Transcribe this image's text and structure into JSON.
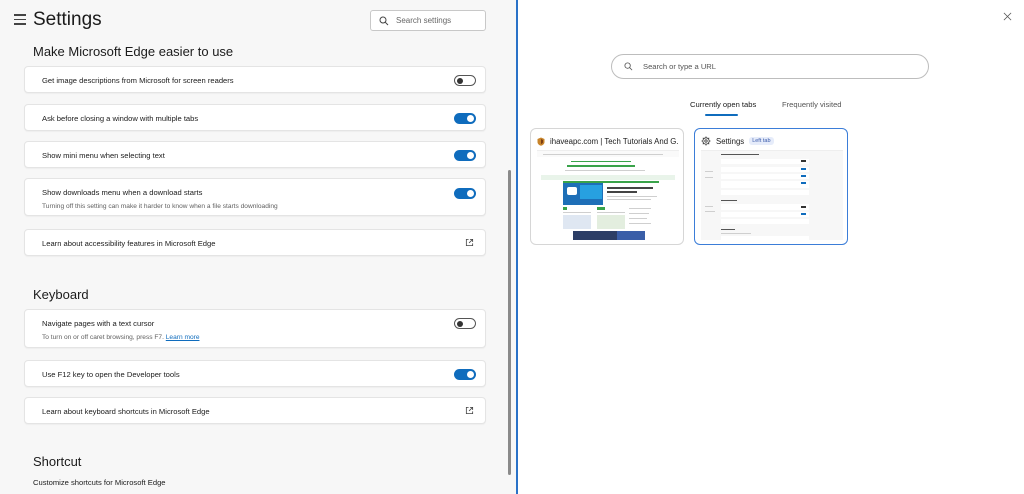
{
  "settings": {
    "title": "Settings",
    "search_placeholder": "Search settings"
  },
  "sections": {
    "accessibility": {
      "title": "Make Microsoft Edge easier to use",
      "items": [
        {
          "label": "Get image descriptions from Microsoft for screen readers",
          "toggle": "off"
        },
        {
          "label": "Ask before closing a window with multiple tabs",
          "toggle": "on"
        },
        {
          "label": "Show mini menu when selecting text",
          "toggle": "on"
        },
        {
          "label": "Show downloads menu when a download starts",
          "sub": "Turning off this setting can make it harder to know when a file starts downloading",
          "toggle": "on"
        },
        {
          "label": "Learn about accessibility features in Microsoft Edge",
          "icon": "external-link-icon"
        }
      ]
    },
    "keyboard": {
      "title": "Keyboard",
      "items": [
        {
          "label": "Navigate pages with a text cursor",
          "sub": "To turn on or off caret browsing, press F7.",
          "link": "Learn more",
          "toggle": "off"
        },
        {
          "label": "Use F12 key to open the Developer tools",
          "toggle": "on"
        },
        {
          "label": "Learn about keyboard shortcuts in Microsoft Edge",
          "icon": "external-link-icon"
        }
      ]
    },
    "shortcut": {
      "title": "Shortcut",
      "text": "Customize shortcuts for Microsoft Edge"
    }
  },
  "newtab": {
    "url_placeholder": "Search or type a URL",
    "tabs": [
      "Currently open tabs",
      "Frequently visited"
    ],
    "active_tab": "Currently open tabs",
    "tiles": [
      {
        "title": "ihaveapc.com | Tech Tutorials And G...",
        "favicon": "ihaveapc-favicon-icon"
      },
      {
        "title": "Settings",
        "badge": "Left tab",
        "favicon": "gear-icon"
      }
    ]
  },
  "colors": {
    "accent": "#0f6cbd",
    "divider": "#2a72c8",
    "pane_bg": "#f7f7f7"
  }
}
